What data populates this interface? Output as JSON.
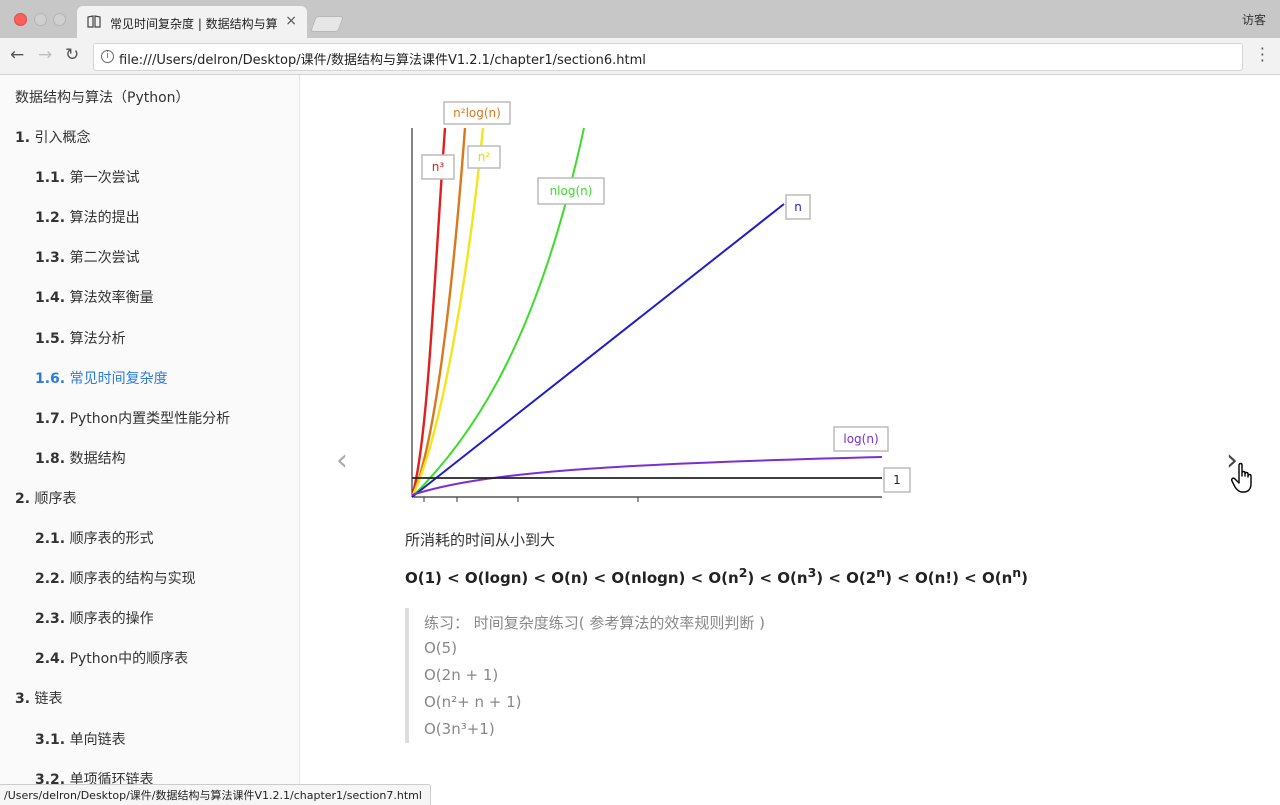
{
  "browser": {
    "tab_title": "常见时间复杂度 | 数据结构与算",
    "tab_close": "×",
    "guest_label": "访客",
    "url": "file:///Users/delron/Desktop/课件/数据结构与算法课件V1.2.1/chapter1/section6.html",
    "back_icon": "←",
    "forward_icon": "→",
    "reload_icon": "↻",
    "info_icon": "i",
    "status_url": "/Users/delron/Desktop/课件/数据结构与算法课件V1.2.1/chapter1/section7.html"
  },
  "sidebar": {
    "title": "数据结构与算法（Python）",
    "items": [
      {
        "num": "1.",
        "label": "引入概念"
      },
      {
        "num": "1.1.",
        "label": "第一次尝试"
      },
      {
        "num": "1.2.",
        "label": "算法的提出"
      },
      {
        "num": "1.3.",
        "label": "第二次尝试"
      },
      {
        "num": "1.4.",
        "label": "算法效率衡量"
      },
      {
        "num": "1.5.",
        "label": "算法分析"
      },
      {
        "num": "1.6.",
        "label": "常见时间复杂度"
      },
      {
        "num": "1.7.",
        "label": "Python内置类型性能分析"
      },
      {
        "num": "1.8.",
        "label": "数据结构"
      },
      {
        "num": "2.",
        "label": "顺序表"
      },
      {
        "num": "2.1.",
        "label": "顺序表的形式"
      },
      {
        "num": "2.2.",
        "label": "顺序表的结构与实现"
      },
      {
        "num": "2.3.",
        "label": "顺序表的操作"
      },
      {
        "num": "2.4.",
        "label": "Python中的顺序表"
      },
      {
        "num": "3.",
        "label": "链表"
      },
      {
        "num": "3.1.",
        "label": "单向链表"
      },
      {
        "num": "3.2.",
        "label": "单项循环链表"
      }
    ],
    "active_color": "#2a7ae2"
  },
  "content": {
    "prev_arrow": "‹",
    "next_arrow": "›",
    "caption": "所消耗的时间从小到大",
    "formula": {
      "a": "O(1) < O(logn) < O(n) < O(nlogn) < O(n",
      "sup2": "2",
      "b": ") < O(n",
      "sup3": "3",
      "c": ") < O(2",
      "supn1": "n",
      "d": ") < O(n!) < O(n",
      "supn2": "n",
      "e": ")"
    },
    "exercise": {
      "title": "练习：  时间复杂度练习( 参考算法的效率规则判断 )",
      "items": [
        "O(5)",
        "O(2n + 1)",
        "O(n²+ n + 1)",
        "O(3n³+1)"
      ]
    }
  },
  "chart_data": {
    "type": "line",
    "title": "",
    "xlabel": "",
    "ylabel": "",
    "series": [
      {
        "name": "n³",
        "color": "#e0201e"
      },
      {
        "name": "n²log(n)",
        "color": "#d9781c"
      },
      {
        "name": "n²",
        "color": "#f2e51d"
      },
      {
        "name": "nlog(n)",
        "color": "#3ddc2c"
      },
      {
        "name": "n",
        "color": "#1f1fc9"
      },
      {
        "name": "log(n)",
        "color": "#7a2fd0"
      },
      {
        "name": "1",
        "color": "#222222"
      }
    ]
  }
}
